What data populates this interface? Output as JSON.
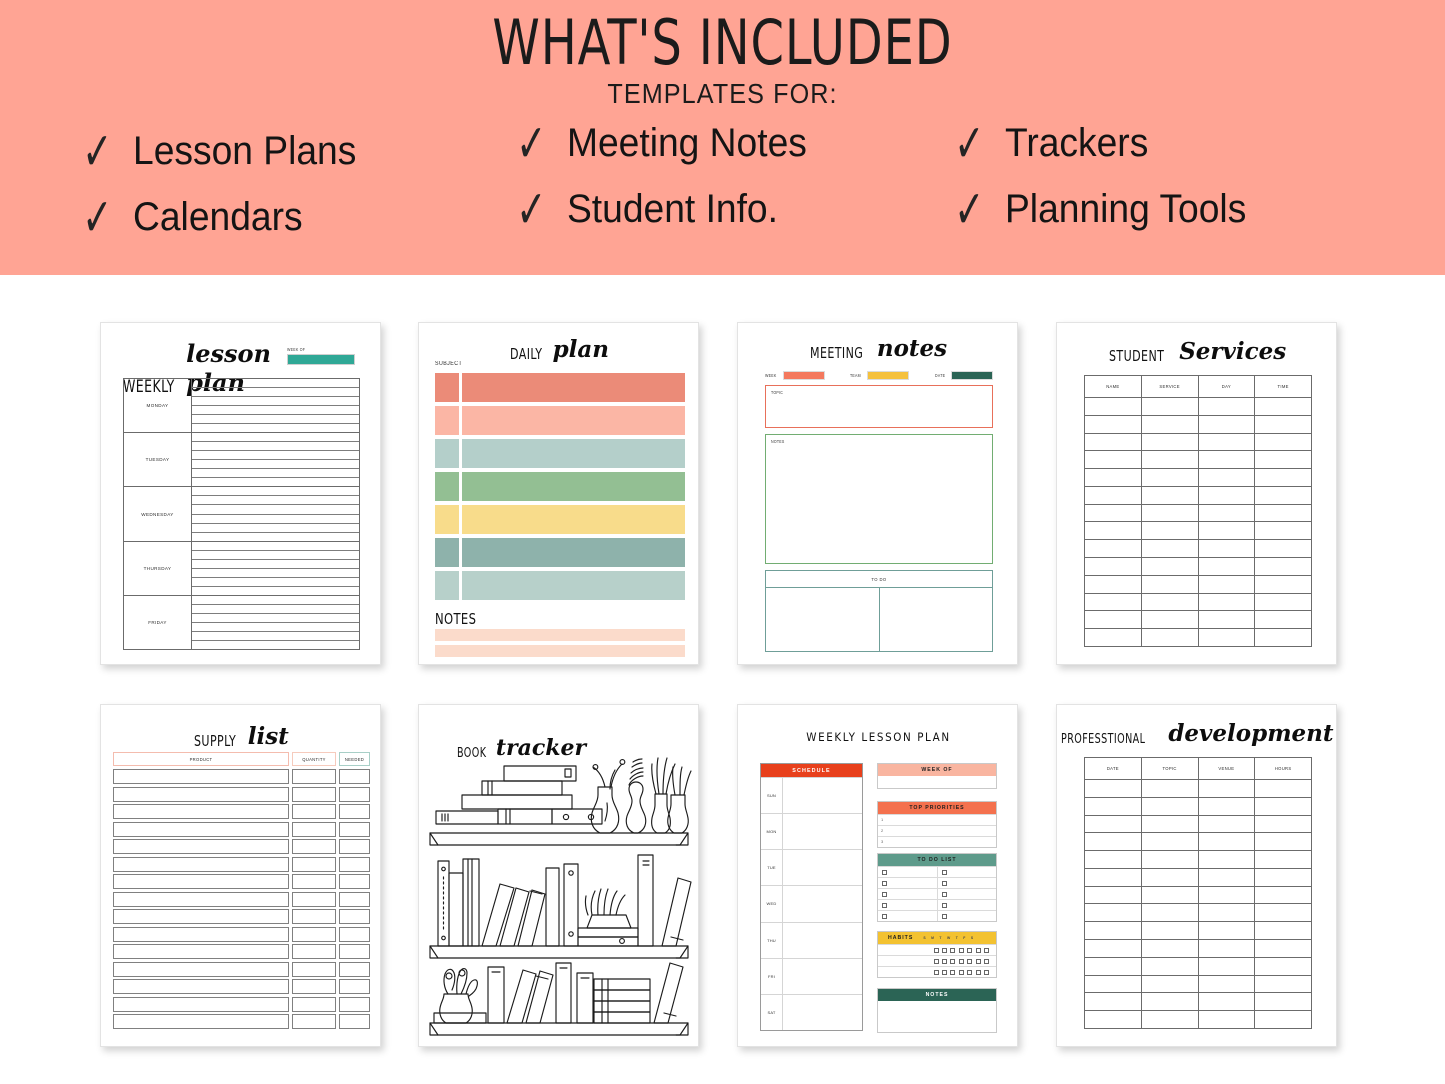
{
  "banner": {
    "title": "WHAT'S INCLUDED",
    "subtitle": "TEMPLATES FOR:",
    "check_glyph": "✓",
    "bg_color": "#ffa494",
    "columns": [
      {
        "items": [
          "Lesson Plans",
          "Calendars"
        ]
      },
      {
        "items": [
          "Meeting Notes",
          "Student Info."
        ]
      },
      {
        "items": [
          "Trackers",
          "Planning Tools"
        ]
      }
    ]
  },
  "sheets": {
    "weekly_lesson_plan": {
      "title_block": "WEEKLY",
      "title_script": "lesson plan",
      "week_of_label": "WEEK OF",
      "week_of_color": "#2fa896",
      "days": [
        "MONDAY",
        "TUESDAY",
        "WEDNESDAY",
        "THURSDAY",
        "FRIDAY"
      ],
      "lines_per_day": 6
    },
    "daily_plan": {
      "title_block": "DAILY",
      "title_script": "plan",
      "subject_label": "SUBJECT",
      "notes_label": "NOTES",
      "row_colors": [
        "#eb8b78",
        "#fbb6a5",
        "#b4cfca",
        "#93bf93",
        "#f8dc8b",
        "#8eb2ab",
        "#b7d0ca"
      ],
      "note_bar_color": "#fbdbcb",
      "note_bars": 2
    },
    "meeting_notes": {
      "title_block": "MEETING",
      "title_script": "notes",
      "fields": [
        {
          "label": "WEEK",
          "color": "#f4795e"
        },
        {
          "label": "TEAM",
          "color": "#f5c13d"
        },
        {
          "label": "DATE",
          "color": "#2b6455"
        }
      ],
      "topic_label": "TOPIC",
      "topic_border": "#e8705a",
      "notes_label": "NOTES",
      "notes_border": "#72ad72",
      "todo_label": "TO DO",
      "todo_border": "#6f9e98"
    },
    "student_services": {
      "title_block": "STUDENT",
      "title_script": "Services",
      "columns": [
        "NAME",
        "SERVICE",
        "DAY",
        "TIME"
      ],
      "rows": 14
    },
    "supply_list": {
      "title_block": "SUPPLY",
      "title_script": "list",
      "columns": [
        "PRODUCT",
        "QUANTITY",
        "NEEDED"
      ],
      "rows": 15
    },
    "book_tracker": {
      "title_block": "BOOK",
      "title_script": "tracker",
      "artwork": "bookshelf-line-art",
      "shelves": 3
    },
    "weekly_lesson_plan_blocks": {
      "title": "WEEKLY LESSON PLAN",
      "schedule_header": "SCHEDULE",
      "schedule_header_color": "#e8401c",
      "schedule_days": [
        "SUN",
        "MON",
        "TUE",
        "WED",
        "THU",
        "FRI",
        "SAT"
      ],
      "week_of_header": "WEEK OF",
      "week_of_color": "#f9b5a0",
      "priorities_header": "TOP PRIORITIES",
      "priorities_color": "#f4714e",
      "priorities": [
        "1",
        "2",
        "3"
      ],
      "todo_header": "TO DO LIST",
      "todo_color": "#5e9b8b",
      "todo_rows": 5,
      "habits_header": "HABITS",
      "habits_color": "#f3c231",
      "habit_days": [
        "S",
        "M",
        "T",
        "W",
        "T",
        "F",
        "S"
      ],
      "habit_rows": 3,
      "notes_header": "NOTES",
      "notes_color": "#2b6455"
    },
    "professional_development": {
      "title_block": "PROFESSTIONAL",
      "title_script": "development",
      "columns": [
        "DATE",
        "TOPIC",
        "VENUE",
        "HOURS"
      ],
      "rows": 14
    }
  }
}
